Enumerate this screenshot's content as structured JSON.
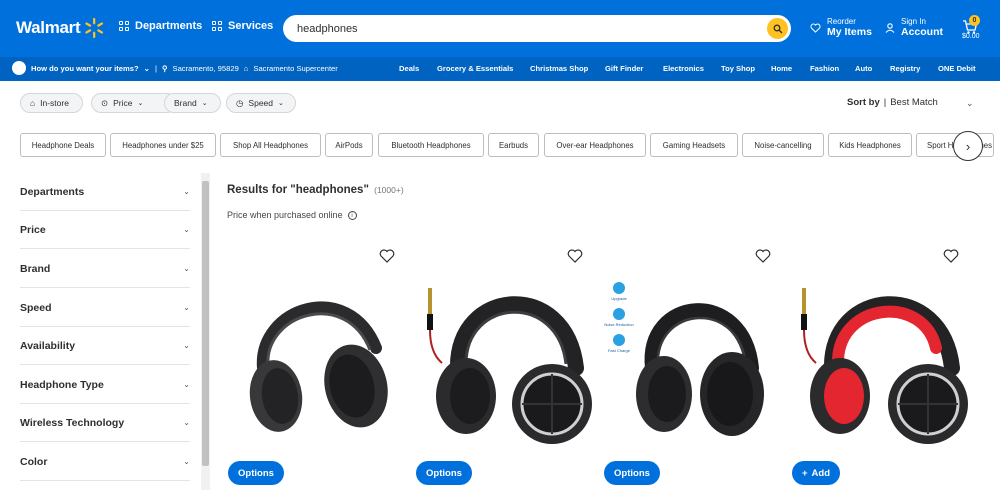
{
  "header": {
    "logo_text": "Walmart",
    "departments": "Departments",
    "services": "Services",
    "search_value": "headphones",
    "reorder_small": "Reorder",
    "reorder_big": "My Items",
    "signin_small": "Sign In",
    "signin_big": "Account",
    "cart_count": "0",
    "cart_total": "$0.00"
  },
  "subnav": {
    "how": "How do you want your items?",
    "zip": "Sacramento, 95829",
    "store": "Sacramento Supercenter",
    "categories": [
      "Deals",
      "Grocery & Essentials",
      "Christmas Shop",
      "Gift Finder",
      "Electronics",
      "Toy Shop",
      "Home",
      "Fashion",
      "Auto",
      "Registry",
      "ONE Debit"
    ]
  },
  "filters": {
    "chips": [
      "In-store",
      "Price",
      "Brand",
      "Speed"
    ],
    "sort_label": "Sort by",
    "sort_value": "Best Match"
  },
  "pills": [
    "Headphone Deals",
    "Headphones under $25",
    "Shop All Headphones",
    "AirPods",
    "Bluetooth Headphones",
    "Earbuds",
    "Over-ear Headphones",
    "Gaming Headsets",
    "Noise-cancelling",
    "Kids Headphones",
    "Sport Headphones"
  ],
  "sidebar": {
    "items": [
      "Departments",
      "Price",
      "Brand",
      "Speed",
      "Availability",
      "Headphone Type",
      "Wireless Technology",
      "Color"
    ]
  },
  "results": {
    "title": "Results for \"headphones\"",
    "count": "(1000+)",
    "price_note": "Price when purchased online"
  },
  "products": [
    {
      "button": "Options"
    },
    {
      "button": "Options"
    },
    {
      "button": "Options",
      "badges": [
        "Upgrade",
        "Noise Reduction",
        "Fast Charge"
      ]
    },
    {
      "button": "Add"
    }
  ],
  "colors": {
    "brand_blue": "#0071dc",
    "spark_yellow": "#ffc220",
    "accent_red": "#e3262f"
  }
}
